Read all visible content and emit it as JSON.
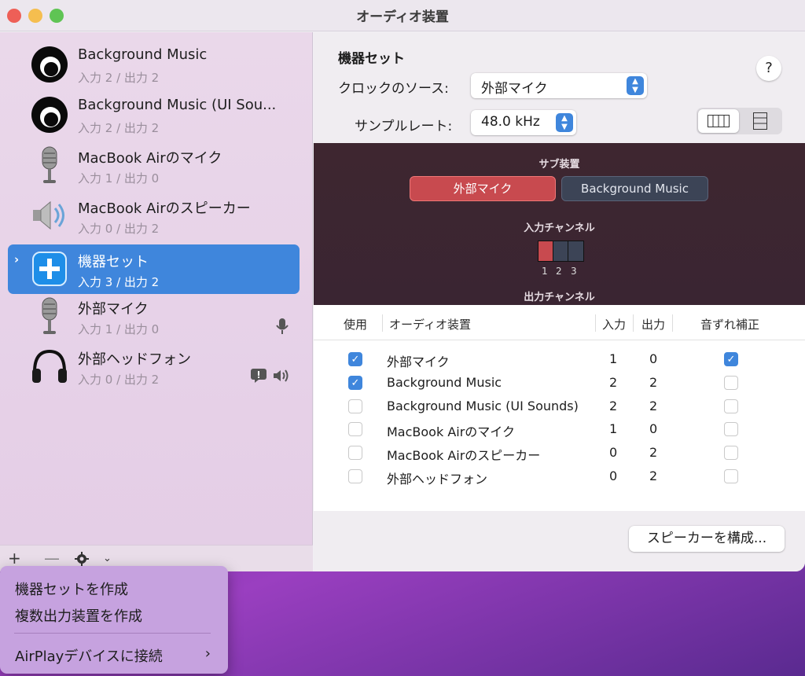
{
  "window": {
    "title": "オーディオ装置"
  },
  "sidebar": {
    "devices": [
      {
        "name": "Background Music",
        "io": "入力 2 / 出力 2",
        "icon": "background-music-icon"
      },
      {
        "name": "Background Music (UI Sou...",
        "io": "入力 2 / 出力 2",
        "icon": "background-music-icon"
      },
      {
        "name": "MacBook Airのマイク",
        "io": "入力 1 / 出力 0",
        "icon": "microphone-icon"
      },
      {
        "name": "MacBook Airのスピーカー",
        "io": "入力 0 / 出力 2",
        "icon": "speaker-icon"
      },
      {
        "name": "機器セット",
        "io": "入力 3 / 出力 2",
        "icon": "aggregate-device-icon",
        "selected": true
      },
      {
        "name": "外部マイク",
        "io": "入力 1 / 出力 0",
        "icon": "microphone-icon"
      },
      {
        "name": "外部ヘッドフォン",
        "io": "入力 0 / 出力 2",
        "icon": "headphones-icon"
      }
    ],
    "footer": {
      "add": "+",
      "remove": "—"
    }
  },
  "menu": {
    "items": [
      "機器セットを作成",
      "複数出力装置を作成",
      "AirPlayデバイスに接続"
    ]
  },
  "main": {
    "title": "機器セット",
    "help": "?",
    "clock_label": "クロックのソース:",
    "clock_value": "外部マイク",
    "rate_label": "サンプルレート:",
    "rate_value": "48.0 kHz",
    "sub_devices_label": "サブ装置",
    "sub_devices": [
      "外部マイク",
      "Background Music"
    ],
    "input_channels_label": "入力チャンネル",
    "channel_numbers": [
      "1",
      "2",
      "3"
    ],
    "output_channels_label": "出力チャンネル",
    "table": {
      "headers": {
        "use": "使用",
        "device": "オーディオ装置",
        "in": "入力",
        "out": "出力",
        "drift": "音ずれ補正"
      },
      "rows": [
        {
          "use": true,
          "name": "外部マイク",
          "in": "1",
          "out": "0",
          "drift": true
        },
        {
          "use": true,
          "name": "Background Music",
          "in": "2",
          "out": "2",
          "drift": false
        },
        {
          "use": false,
          "name": "Background Music (UI Sounds)",
          "in": "2",
          "out": "2",
          "drift": false
        },
        {
          "use": false,
          "name": "MacBook Airのマイク",
          "in": "1",
          "out": "0",
          "drift": false
        },
        {
          "use": false,
          "name": "MacBook Airのスピーカー",
          "in": "0",
          "out": "2",
          "drift": false
        },
        {
          "use": false,
          "name": "外部ヘッドフォン",
          "in": "0",
          "out": "2",
          "drift": false
        }
      ]
    },
    "configure_speakers": "スピーカーを構成..."
  }
}
